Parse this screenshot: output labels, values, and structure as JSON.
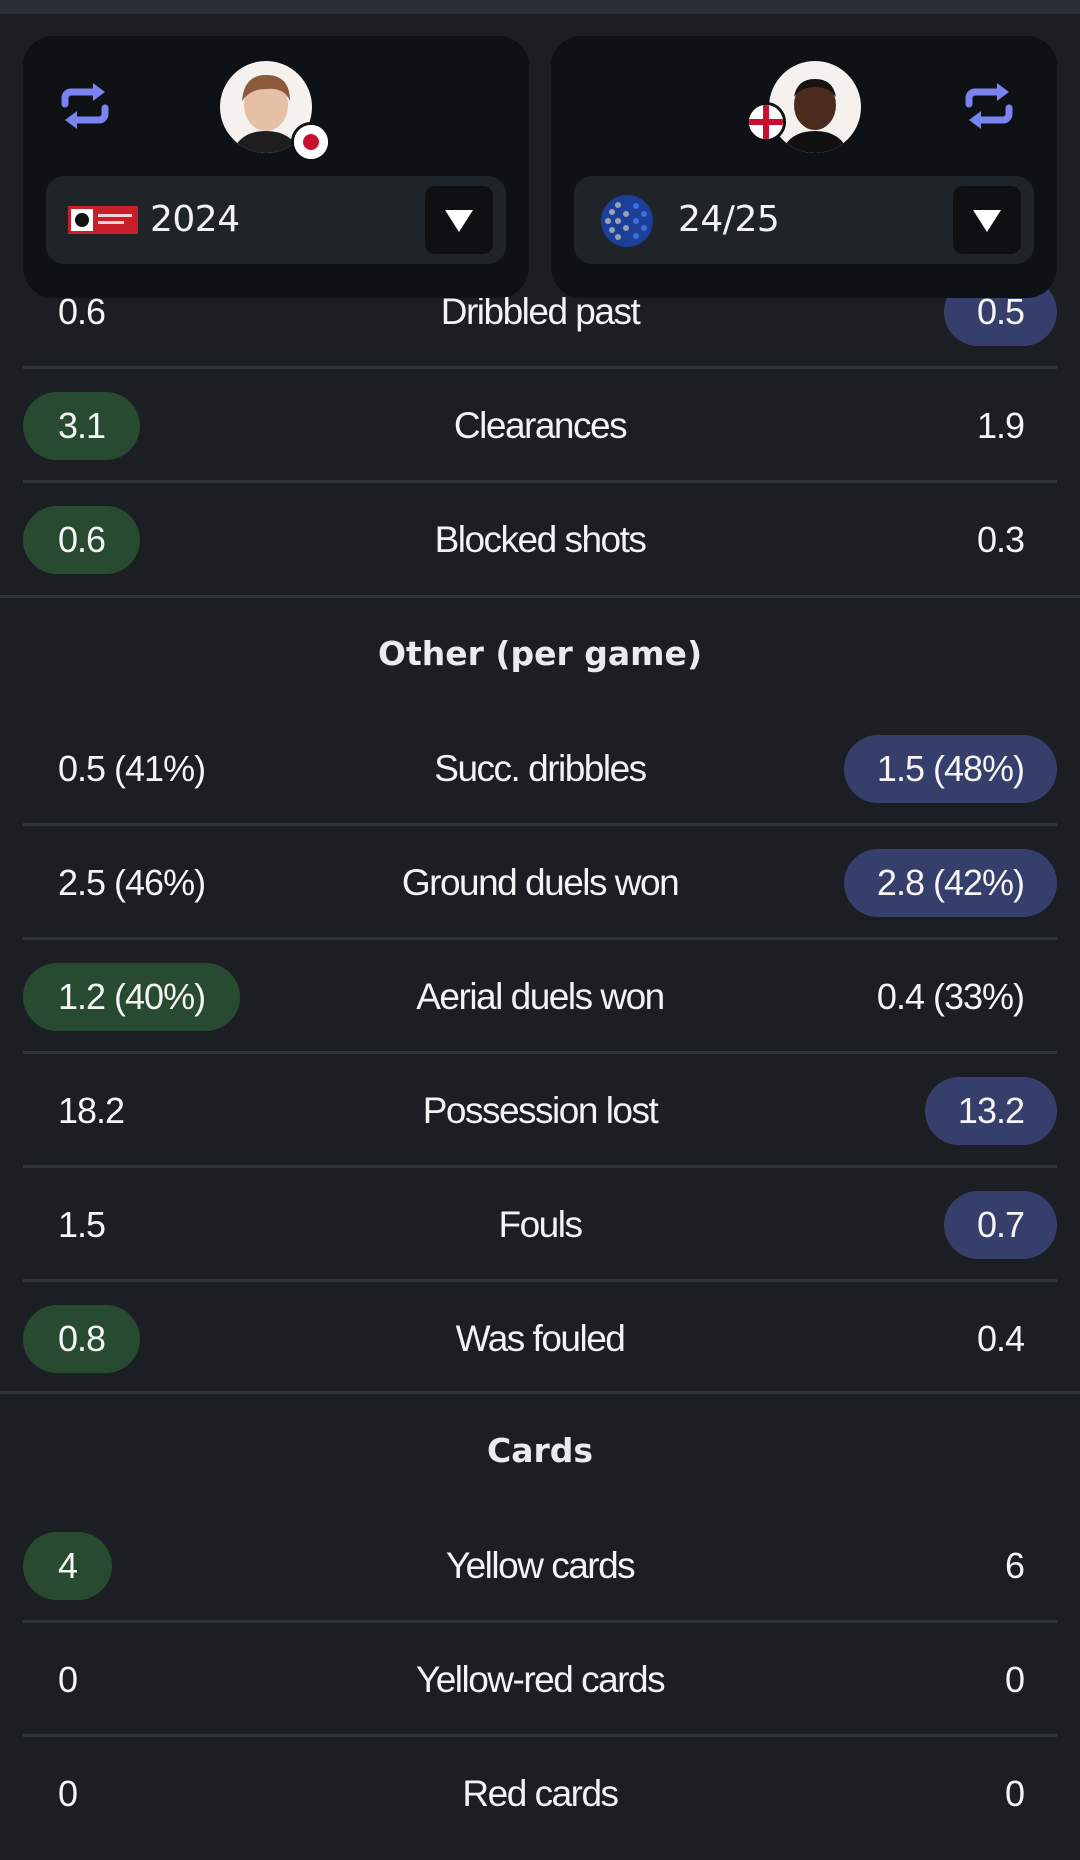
{
  "header": {
    "left_player": {
      "season": "2024",
      "league_icon": "j1-league-logo",
      "flag_icon": "japan-flag-icon"
    },
    "right_player": {
      "season": "24/25",
      "league_icon": "club-crest-icon",
      "flag_icon": "england-flag-icon"
    }
  },
  "partial_row": {
    "label": "Dribbled past",
    "left": "0.6",
    "right": "0.5"
  },
  "defending_rows": [
    {
      "label": "Clearances",
      "left": "3.1",
      "right": "1.9",
      "highlight": "left"
    },
    {
      "label": "Blocked shots",
      "left": "0.6",
      "right": "0.3",
      "highlight": "left"
    }
  ],
  "sections": {
    "other_title": "Other (per game)",
    "cards_title": "Cards"
  },
  "other_rows": [
    {
      "label": "Succ. dribbles",
      "left": "0.5 (41%)",
      "right": "1.5 (48%)",
      "highlight": "right"
    },
    {
      "label": "Ground duels won",
      "left": "2.5 (46%)",
      "right": "2.8 (42%)",
      "highlight": "right"
    },
    {
      "label": "Aerial duels won",
      "left": "1.2 (40%)",
      "right": "0.4 (33%)",
      "highlight": "left"
    },
    {
      "label": "Possession lost",
      "left": "18.2",
      "right": "13.2",
      "highlight": "right"
    },
    {
      "label": "Fouls",
      "left": "1.5",
      "right": "0.7",
      "highlight": "right"
    },
    {
      "label": "Was fouled",
      "left": "0.8",
      "right": "0.4",
      "highlight": "left"
    }
  ],
  "card_rows": [
    {
      "label": "Yellow cards",
      "left": "4",
      "right": "6",
      "highlight": "left"
    },
    {
      "label": "Yellow-red cards",
      "left": "0",
      "right": "0",
      "highlight": "none"
    },
    {
      "label": "Red cards",
      "left": "0",
      "right": "0",
      "highlight": "none"
    }
  ],
  "colors": {
    "background": "#1b1f24",
    "card": "#0f1215",
    "left_highlight": "#284a30",
    "right_highlight": "#363f6b",
    "swap_icon": "#7a83f0"
  }
}
